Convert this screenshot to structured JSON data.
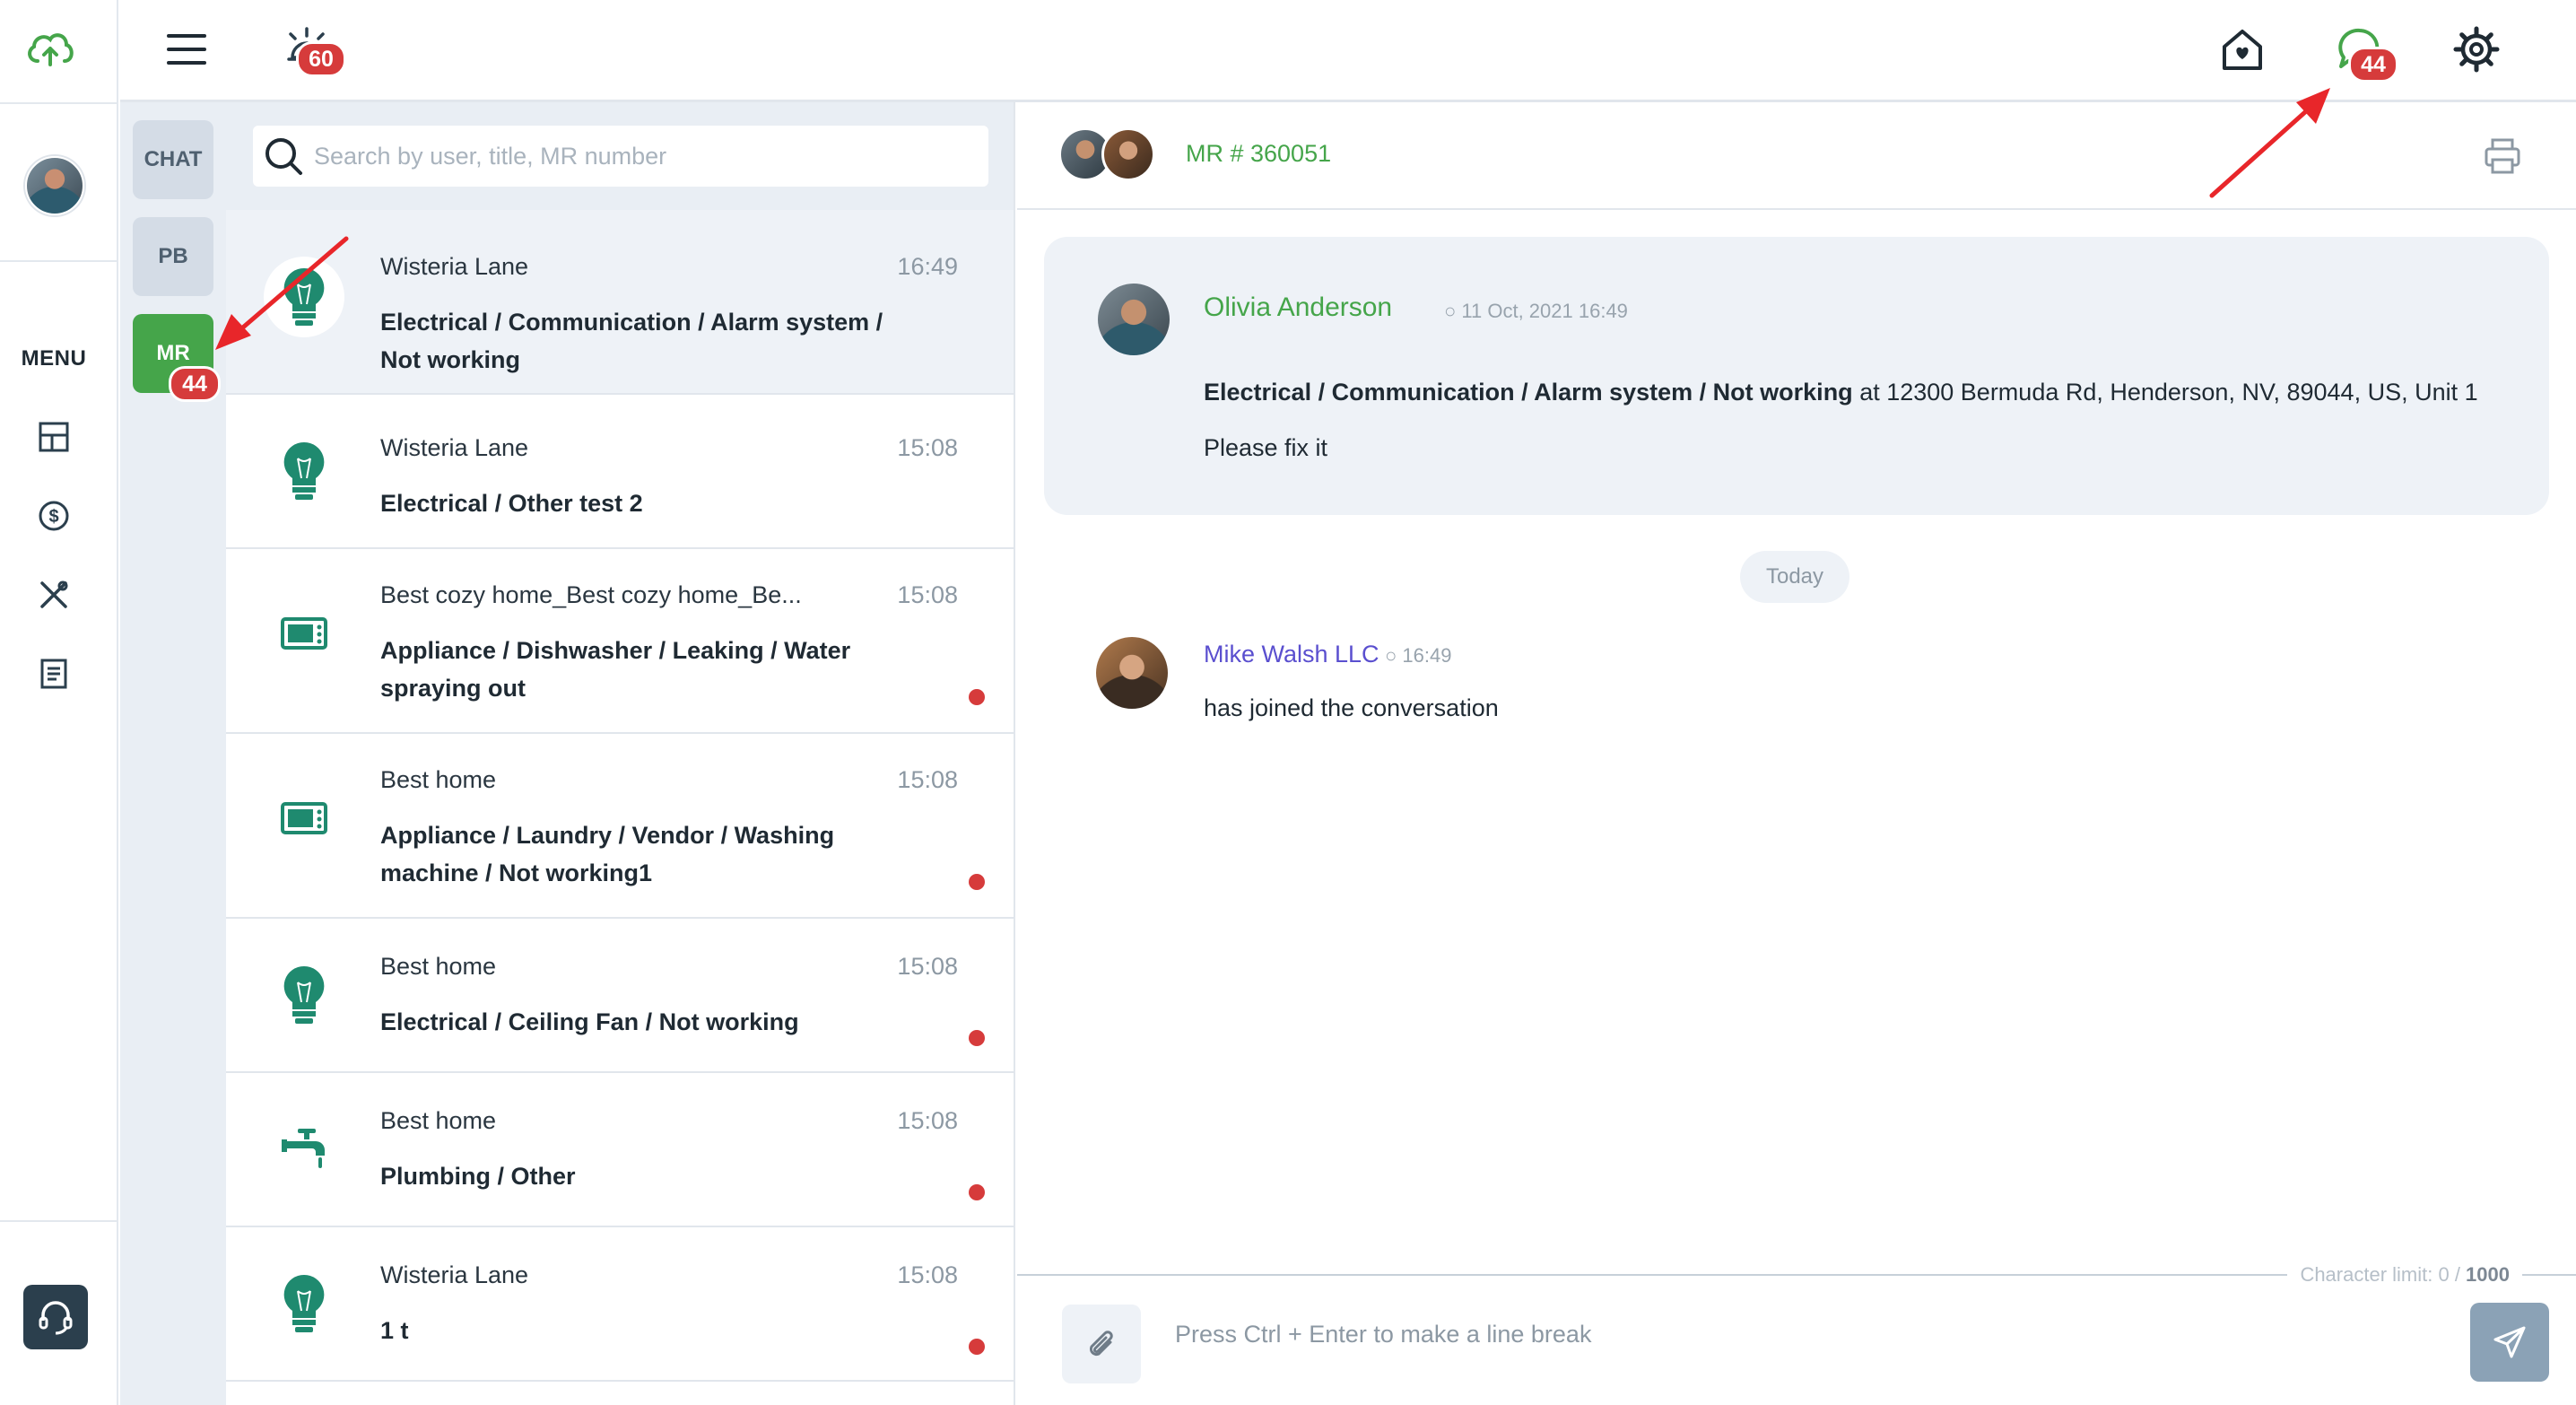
{
  "colors": {
    "brand_green": "#45a54a",
    "badge_red": "#d63b3b",
    "sender_green": "#45a54a",
    "sender_purple": "#5a4fcf",
    "annotation_red": "#e8262a"
  },
  "rail": {
    "logo_icon": "cloud-upload-icon",
    "menu_label": "MENU",
    "nav": [
      {
        "name": "dashboard-icon"
      },
      {
        "name": "dollar-icon"
      },
      {
        "name": "tools-icon"
      },
      {
        "name": "document-icon"
      }
    ],
    "support_icon": "headset-icon"
  },
  "topbar": {
    "alarm_badge": "60",
    "chat_badge": "44"
  },
  "tabs": [
    {
      "label": "CHAT",
      "active": false
    },
    {
      "label": "PB",
      "active": false
    },
    {
      "label": "MR",
      "active": true,
      "badge": "44"
    }
  ],
  "search": {
    "placeholder": "Search by user, title, MR number"
  },
  "list": [
    {
      "icon": "lightbulb-icon",
      "title": "Wisteria Lane",
      "time": "16:49",
      "desc": "Electrical / Communication / Alarm system / Not working",
      "unread": false,
      "selected": true
    },
    {
      "icon": "lightbulb-icon",
      "title": "Wisteria Lane",
      "time": "15:08",
      "desc": "Electrical / Other test 2",
      "unread": false,
      "selected": false
    },
    {
      "icon": "microwave-icon",
      "title": "Best cozy home_Best cozy home_Be...",
      "time": "15:08",
      "desc": "Appliance / Dishwasher / Leaking / Water spraying out",
      "unread": true,
      "selected": false
    },
    {
      "icon": "microwave-icon",
      "title": "Best home",
      "time": "15:08",
      "desc": "Appliance / Laundry / Vendor / Washing machine / Not working1",
      "unread": true,
      "selected": false
    },
    {
      "icon": "lightbulb-icon",
      "title": "Best home",
      "time": "15:08",
      "desc": "Electrical / Ceiling Fan / Not working",
      "unread": true,
      "selected": false
    },
    {
      "icon": "faucet-icon",
      "title": "Best home",
      "time": "15:08",
      "desc": "Plumbing / Other",
      "unread": true,
      "selected": false
    },
    {
      "icon": "lightbulb-icon",
      "title": "Wisteria Lane",
      "time": "15:08",
      "desc": "1 t",
      "unread": true,
      "selected": false
    }
  ],
  "conversation": {
    "mr_number": "MR # 360051",
    "first_message": {
      "sender": "Olivia Anderson",
      "time": "11 Oct, 2021 16:49",
      "category": "Electrical / Communication / Alarm system / Not working",
      "address": " at 12300 Bermuda Rd, Henderson, NV, 89044, US, Unit 1",
      "note": "Please fix it"
    },
    "divider": "Today",
    "messages": [
      {
        "sender": "Mike Walsh LLC",
        "time": "16:49",
        "text": "has joined the conversation"
      }
    ]
  },
  "composer": {
    "char_limit_label": "Character limit: 0 / ",
    "char_limit_max": "1000",
    "placeholder": "Press Ctrl + Enter to make a line break"
  }
}
